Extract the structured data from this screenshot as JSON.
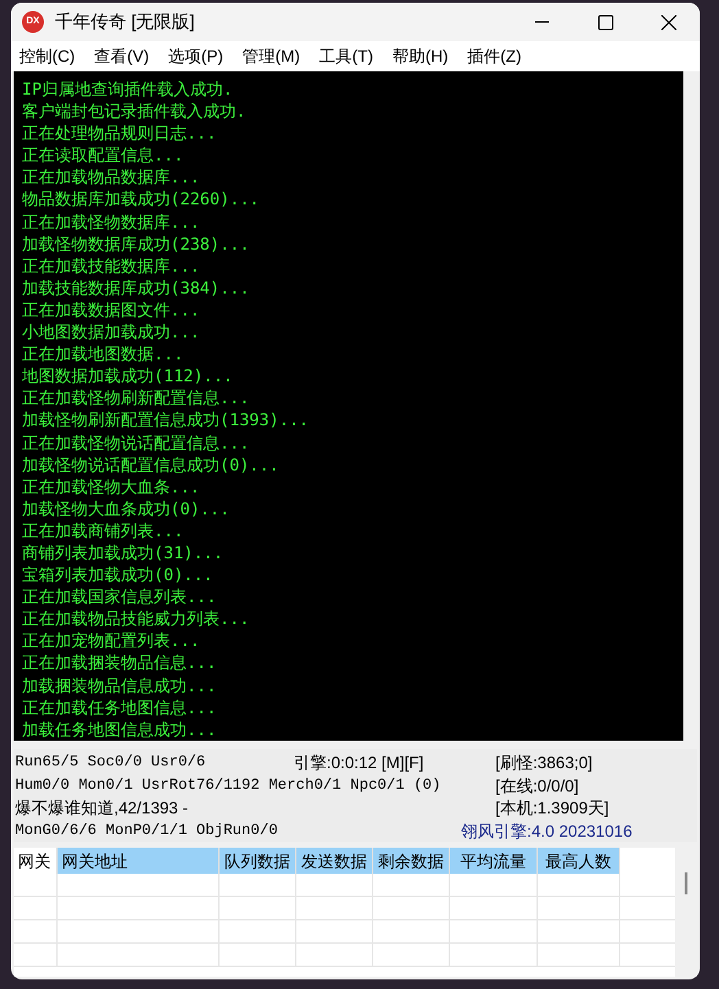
{
  "window": {
    "title": "千年传奇 [无限版]",
    "icon_text": "DX"
  },
  "menu": [
    "控制(C)",
    "查看(V)",
    "选项(P)",
    "管理(M)",
    "工具(T)",
    "帮助(H)",
    "插件(Z)"
  ],
  "log": [
    "IP归属地查询插件载入成功.",
    "客户端封包记录插件载入成功.",
    "正在处理物品规则日志...",
    "正在读取配置信息...",
    "正在加载物品数据库...",
    "物品数据库加载成功(2260)...",
    "正在加载怪物数据库...",
    "加载怪物数据库成功(238)...",
    "正在加载技能数据库...",
    "加载技能数据库成功(384)...",
    "正在加载数据图文件...",
    "小地图数据加载成功...",
    "正在加载地图数据...",
    "地图数据加载成功(112)...",
    "正在加载怪物刷新配置信息...",
    "加载怪物刷新配置信息成功(1393)...",
    "正在加载怪物说话配置信息...",
    "加载怪物说话配置信息成功(0)...",
    "正在加载怪物大血条...",
    "加载怪物大血条成功(0)...",
    "正在加载商铺列表...",
    "商铺列表加载成功(31)...",
    "宝箱列表加载成功(0)...",
    "正在加载国家信息列表...",
    "正在加载物品技能威力列表...",
    "正在加宠物配置列表...",
    "正在加载捆装物品信息...",
    "加载捆装物品信息成功...",
    "正在加载任务地图信息...",
    "加载任务地图信息成功..."
  ],
  "status": {
    "row_1": {
      "left": "Run65/5 Soc0/0 Usr0/6",
      "middle": "引擎:0:0:12 [M][F]",
      "right": "[刷怪:3863;0]"
    },
    "row_2": {
      "left": "Hum0/0 Mon0/1 UsrRot76/1192 Merch0/1 Npc0/1 (0)",
      "right": "[在线:0/0/0]"
    },
    "row_3": {
      "left": "爆不爆谁知道,42/1393 -",
      "right": "[本机:1.3909天]"
    },
    "row_4": {
      "left": "MonG0/6/6 MonP0/1/1 ObjRun0/0",
      "right": "翎风引擎:4.0 20231016"
    }
  },
  "table": {
    "columns": [
      {
        "label": "网关",
        "selected": false
      },
      {
        "label": "网关地址",
        "selected": true
      },
      {
        "label": "队列数据",
        "selected": true
      },
      {
        "label": "发送数据",
        "selected": true
      },
      {
        "label": "剩余数据",
        "selected": true
      },
      {
        "label": "平均流量",
        "selected": true
      },
      {
        "label": "最高人数",
        "selected": true
      }
    ]
  }
}
